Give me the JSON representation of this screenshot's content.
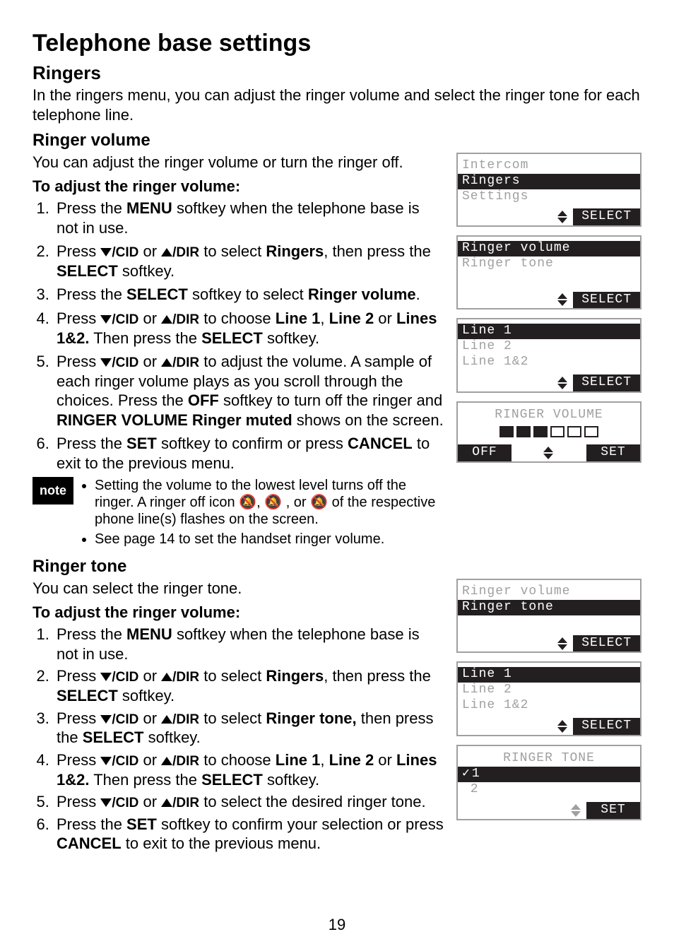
{
  "page_number": "19",
  "title": "Telephone base settings",
  "sections": {
    "ringers": {
      "heading": "Ringers",
      "intro": "In the ringers menu, you can adjust the ringer volume and select the ringer tone for each telephone line."
    },
    "ringer_volume": {
      "heading": "Ringer volume",
      "intro": "You can adjust the ringer volume or turn the ringer off.",
      "adjust_heading": "To adjust the ringer volume:",
      "steps_pre": [
        "Press the ",
        "Press ",
        "Press the ",
        "Press ",
        "Press ",
        "Press the "
      ],
      "steps": {
        "s1_a": "Press the ",
        "s1_key": "MENU",
        "s1_b": " softkey when the telephone base is not in use.",
        "s2_a": "Press ",
        "s2_cid": "/CID",
        "s2_or": " or ",
        "s2_dir": "/DIR",
        "s2_b": " to select ",
        "s2_key": "Ringers",
        "s2_c": ", then press the ",
        "s2_key2": "SELECT",
        "s2_d": " softkey.",
        "s3_a": "Press the ",
        "s3_key": "SELECT",
        "s3_b": " softkey to select ",
        "s3_key2": "Ringer volume",
        "s3_c": ".",
        "s4_a": "Press ",
        "s4_b": " to choose ",
        "s4_l1": "Line 1",
        "s4_sep1": ", ",
        "s4_l2": "Line 2",
        "s4_sep2": " or ",
        "s4_l3": "Lines 1&2.",
        "s4_c": " Then press the ",
        "s4_key": "SELECT",
        "s4_d": " softkey.",
        "s5_a": "Press ",
        "s5_b": " to adjust the volume. A sample of each ringer volume plays as you scroll through the choices. Press the ",
        "s5_off": "OFF",
        "s5_c": " softkey to turn off the ringer and ",
        "s5_muted": "RINGER VOLUME Ringer muted",
        "s5_d": " shows on the screen.",
        "s6_a": "Press the ",
        "s6_set": "SET",
        "s6_b": " softkey to confirm or press ",
        "s6_cancel": "CANCEL",
        "s6_c": " to exit to the previous menu."
      },
      "note_label": "note",
      "note_items": {
        "n1_a": "Setting the volume to the lowest level turns off the ringer. A ringer off icon ",
        "n1_b": " of the respective phone line(s) flashes on the screen.",
        "n1_sep1": ", ",
        "n1_sep2": " , or ",
        "n2": "See page 14 to set the handset ringer volume."
      }
    },
    "ringer_tone": {
      "heading": "Ringer tone",
      "intro": "You can select the ringer tone.",
      "adjust_heading": "To adjust the ringer volume:",
      "steps": {
        "s1_a": "Press the ",
        "s1_key": "MENU",
        "s1_b": " softkey when the telephone base is not in use.",
        "s2_a": "Press ",
        "s2_b": " to select ",
        "s2_key": "Ringers",
        "s2_c": ", then press the ",
        "s2_key2": "SELECT",
        "s2_d": " softkey.",
        "s3_a": "Press ",
        "s3_b": " to select ",
        "s3_key": "Ringer tone,",
        "s3_c": " then press the ",
        "s3_key2": "SELECT",
        "s3_d": " softkey.",
        "s4_a": "Press ",
        "s4_b": " to choose ",
        "s4_l1": "Line 1",
        "s4_sep1": ", ",
        "s4_l2": "Line 2",
        "s4_sep2": " or ",
        "s4_l3": "Lines 1&2.",
        "s4_c": " Then press the ",
        "s4_key": "SELECT",
        "s4_d": " softkey.",
        "s5_a": "Press ",
        "s5_b": " to select the desired ringer tone.",
        "s6_a": "Press the ",
        "s6_set": "SET",
        "s6_b": " softkey to confirm your selection or press ",
        "s6_cancel": "CANCEL",
        "s6_c": " to exit to the previous menu."
      }
    }
  },
  "keys": {
    "cid": "/CID",
    "dir": "/DIR",
    "or": " or "
  },
  "screens": {
    "s1": {
      "r1": "Intercom",
      "r2": "Ringers",
      "r3": "Settings",
      "btn": "SELECT"
    },
    "s2": {
      "r1": "Ringer volume",
      "r2": "Ringer tone",
      "btn": "SELECT"
    },
    "s3": {
      "r1": "Line 1",
      "r2": "Line 2",
      "r3": "Line 1&2",
      "btn": "SELECT"
    },
    "s4": {
      "title": "RINGER VOLUME",
      "off": "OFF",
      "set": "SET"
    },
    "s5": {
      "r1": "Ringer volume",
      "r2": "Ringer tone",
      "btn": "SELECT"
    },
    "s6": {
      "r1": "Line 1",
      "r2": "Line 2",
      "r3": "Line 1&2",
      "btn": "SELECT"
    },
    "s7": {
      "title": "RINGER TONE",
      "r1": "1",
      "r2": " 2",
      "set": "SET"
    }
  }
}
